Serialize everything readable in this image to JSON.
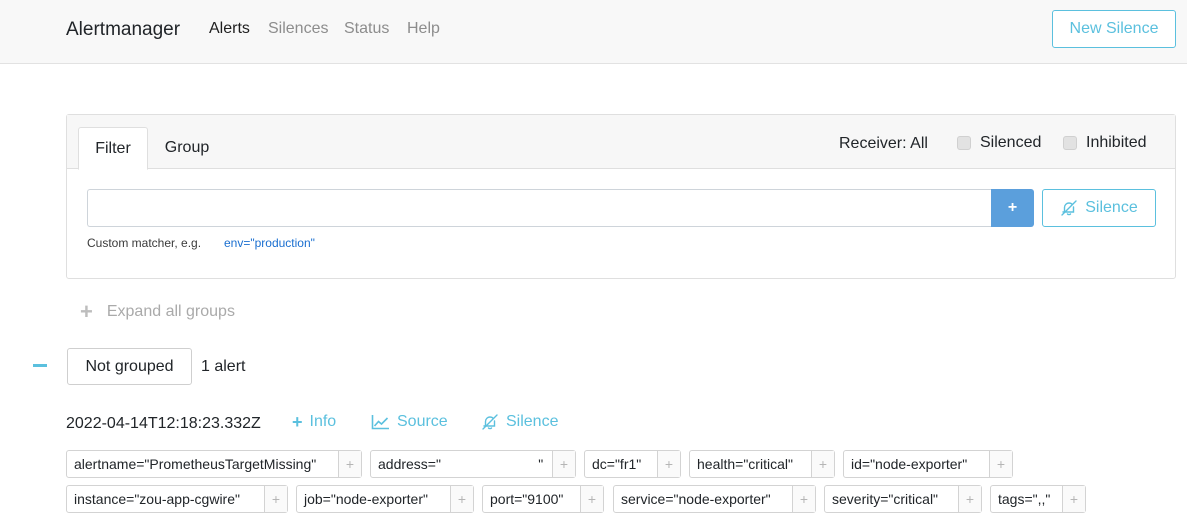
{
  "navbar": {
    "brand": "Alertmanager",
    "links": [
      "Alerts",
      "Silences",
      "Status",
      "Help"
    ],
    "new_silence": "New Silence"
  },
  "filter": {
    "tabs": [
      "Filter",
      "Group"
    ],
    "receiver": "Receiver: All",
    "silenced": "Silenced",
    "inhibited": "Inhibited",
    "input_value": "",
    "add_label": "+",
    "silence_label": "Silence",
    "hint": "Custom matcher, e.g.",
    "hint_example": "env=\"production\""
  },
  "expand_all": "Expand all groups",
  "group": {
    "name": "Not grouped",
    "count": "1 alert"
  },
  "alert": {
    "timestamp": "2022-04-14T12:18:23.332Z",
    "info": "Info",
    "source": "Source",
    "silence": "Silence",
    "labels_row1": [
      "alertname=\"PrometheusTargetMissing\"",
      "address=\"                         \"",
      "dc=\"fr1\"",
      "health=\"critical\"",
      "id=\"node-exporter\""
    ],
    "labels_row2": [
      "instance=\"zou-app-cgwire\"",
      "job=\"node-exporter\"",
      "port=\"9100\"",
      "service=\"node-exporter\"",
      "severity=\"critical\"",
      "tags=\",,\""
    ]
  },
  "colors": {
    "accent": "#5bc0de",
    "primary": "#5b9fdc",
    "link": "#1a6fd0"
  }
}
